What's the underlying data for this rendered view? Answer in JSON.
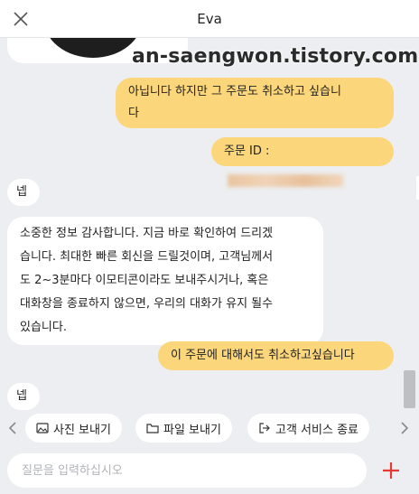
{
  "header": {
    "title": "Eva",
    "close_icon": "close-icon"
  },
  "watermark": "an-saengwon.tistory.com",
  "messages": [
    {
      "side": "left",
      "type": "image"
    },
    {
      "side": "right",
      "text_line1": "아닙니다 하지만 그 주문도 취소하고 싶습니",
      "text_line2": "다"
    },
    {
      "side": "right",
      "text": "주문 ID :",
      "redacted": true
    },
    {
      "side": "left",
      "text": "넵"
    },
    {
      "side": "left",
      "lines": [
        "소중한 정보 감사합니다. 지금 바로 확인하여 드리겠",
        "습니다. 최대한 빠른 회신을 드릴것이며, 고객님께서",
        "도 2~3분마다 이모티콘이라도 보내주시거나, 혹은",
        "대화창을 종료하지 않으면,  우리의 대화가 유지 될수",
        "있습니다."
      ]
    },
    {
      "side": "right",
      "text": "이 주문에 대해서도 취소하고싶습니다"
    },
    {
      "side": "left",
      "text": "넵"
    }
  ],
  "actions": {
    "prev_icon": "chevron-left-icon",
    "next_icon": "chevron-right-icon",
    "items": [
      {
        "label": "사진 보내기",
        "icon": "image-icon"
      },
      {
        "label": "파일 보내기",
        "icon": "folder-icon"
      },
      {
        "label": "고객 서비스 종료",
        "icon": "exit-icon"
      }
    ]
  },
  "input": {
    "placeholder": "질문을 입력하십시오",
    "value": ""
  },
  "colors": {
    "user_bubble": "#fcd67a",
    "agent_bubble": "#ffffff",
    "background": "#eceef1",
    "plus_accent": "#e53935"
  }
}
